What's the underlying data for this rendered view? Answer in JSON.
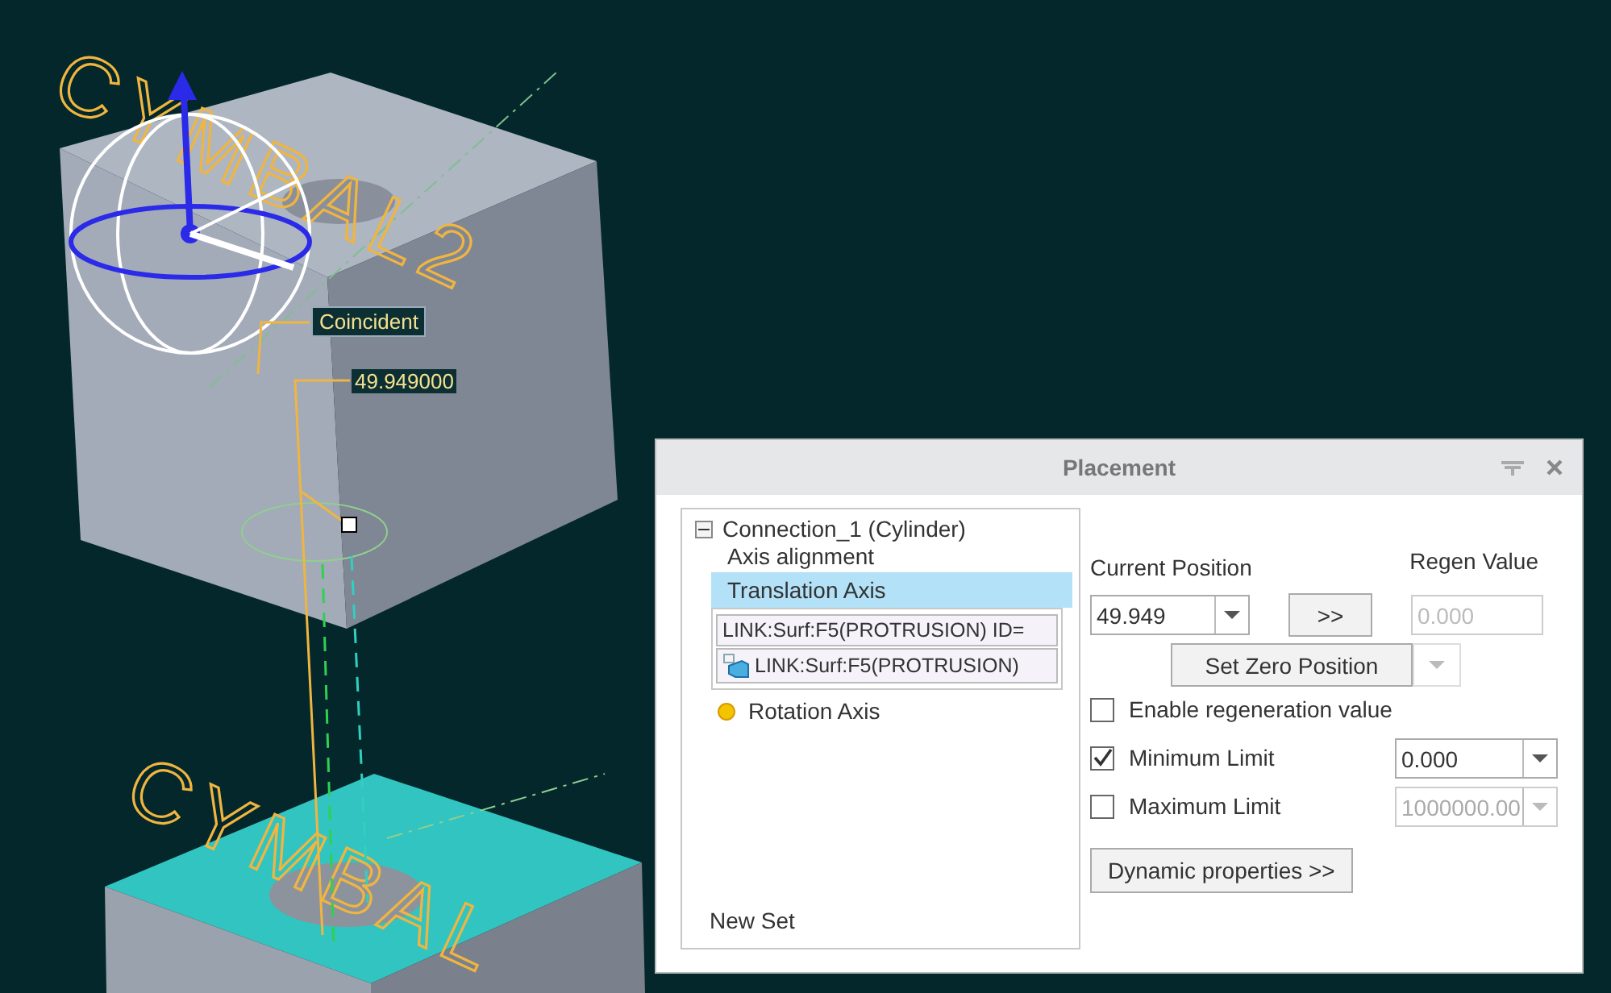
{
  "viewport": {
    "model_labels": [
      "CYMBAL2",
      "CYMBAL"
    ],
    "annotations": [
      {
        "kind": "tag",
        "text": "Coincident"
      },
      {
        "kind": "dimension",
        "text": "49.949000"
      }
    ]
  },
  "dialog": {
    "title": "Placement",
    "tree": {
      "root": {
        "label": "Connection_1 (Cylinder)",
        "expanded": true
      },
      "items": [
        {
          "kind": "heading",
          "label": "Axis alignment"
        },
        {
          "kind": "axis",
          "label": "Translation Axis",
          "selected": true,
          "incomplete": false,
          "references": [
            {
              "kind": "text",
              "label": "LINK:Surf:F5(PROTRUSION) ID="
            },
            {
              "kind": "surface",
              "label": "LINK:Surf:F5(PROTRUSION)"
            }
          ]
        },
        {
          "kind": "axis",
          "label": "Rotation Axis",
          "selected": false,
          "incomplete": true
        }
      ],
      "new_set": "New Set"
    },
    "current_position": {
      "label": "Current Position",
      "value": "49.949"
    },
    "copy_button": ">>",
    "regen": {
      "label": "Regen Value",
      "value": "0.000",
      "disabled": true
    },
    "set_zero": {
      "label": "Set Zero Position",
      "menu_disabled": true
    },
    "options": [
      {
        "label": "Enable regeneration value",
        "checked": false
      },
      {
        "label": "Minimum Limit",
        "checked": true,
        "value": "0.000",
        "disabled": false
      },
      {
        "label": "Maximum Limit",
        "checked": false,
        "value": "1000000.00",
        "disabled": true
      }
    ],
    "dynamic_button": "Dynamic properties >>"
  }
}
